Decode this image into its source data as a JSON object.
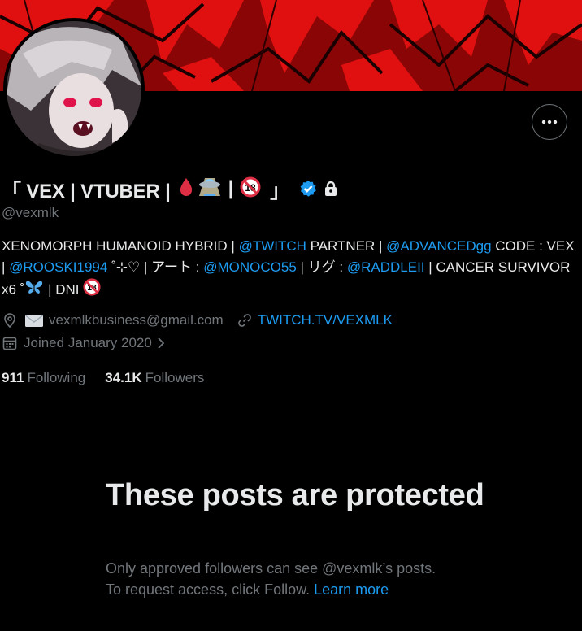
{
  "profile": {
    "display_name_part1": "「 VEX | VTUBER |",
    "display_name_sep": "|",
    "display_name_end": "」",
    "age_badge": "18",
    "handle": "@vexmlk",
    "verified_icon": "verified-badge-icon",
    "lock_icon": "lock-icon"
  },
  "bio": {
    "seg1": "XENOMORPH HUMANOID HYBRID | ",
    "link1": "@TWITCH",
    "seg2": " PARTNER | ",
    "link2": "@ADVANCEDgg",
    "seg3": " CODE : VEX | ",
    "link3": "@ROOSKI1994",
    "seg4": " ˚⊹♡ | アート : ",
    "link4": "@MONOCO55",
    "seg5": " | リグ : ",
    "link5": "@RADDLEII",
    "seg6": " | CANCER SURVIVOR x6 ˚",
    "seg7": " | DNI ",
    "age_badge": "18"
  },
  "meta": {
    "email": "vexmlkbusiness@gmail.com",
    "website": "TWITCH.TV/VEXMLK",
    "joined": "Joined January 2020"
  },
  "stats": {
    "following_count": "911",
    "following_label": "Following",
    "followers_count": "34.1K",
    "followers_label": "Followers"
  },
  "protected": {
    "title": "These posts are protected",
    "desc_line1": "Only approved followers can see @vexmlk’s posts.",
    "desc_line2": "To request access, click Follow.",
    "learn_more": "Learn more"
  },
  "colors": {
    "background": "#000000",
    "text_primary": "#e7e9ea",
    "text_secondary": "#71767b",
    "link": "#1d9bf0",
    "banner_red": "#c80a0a"
  }
}
